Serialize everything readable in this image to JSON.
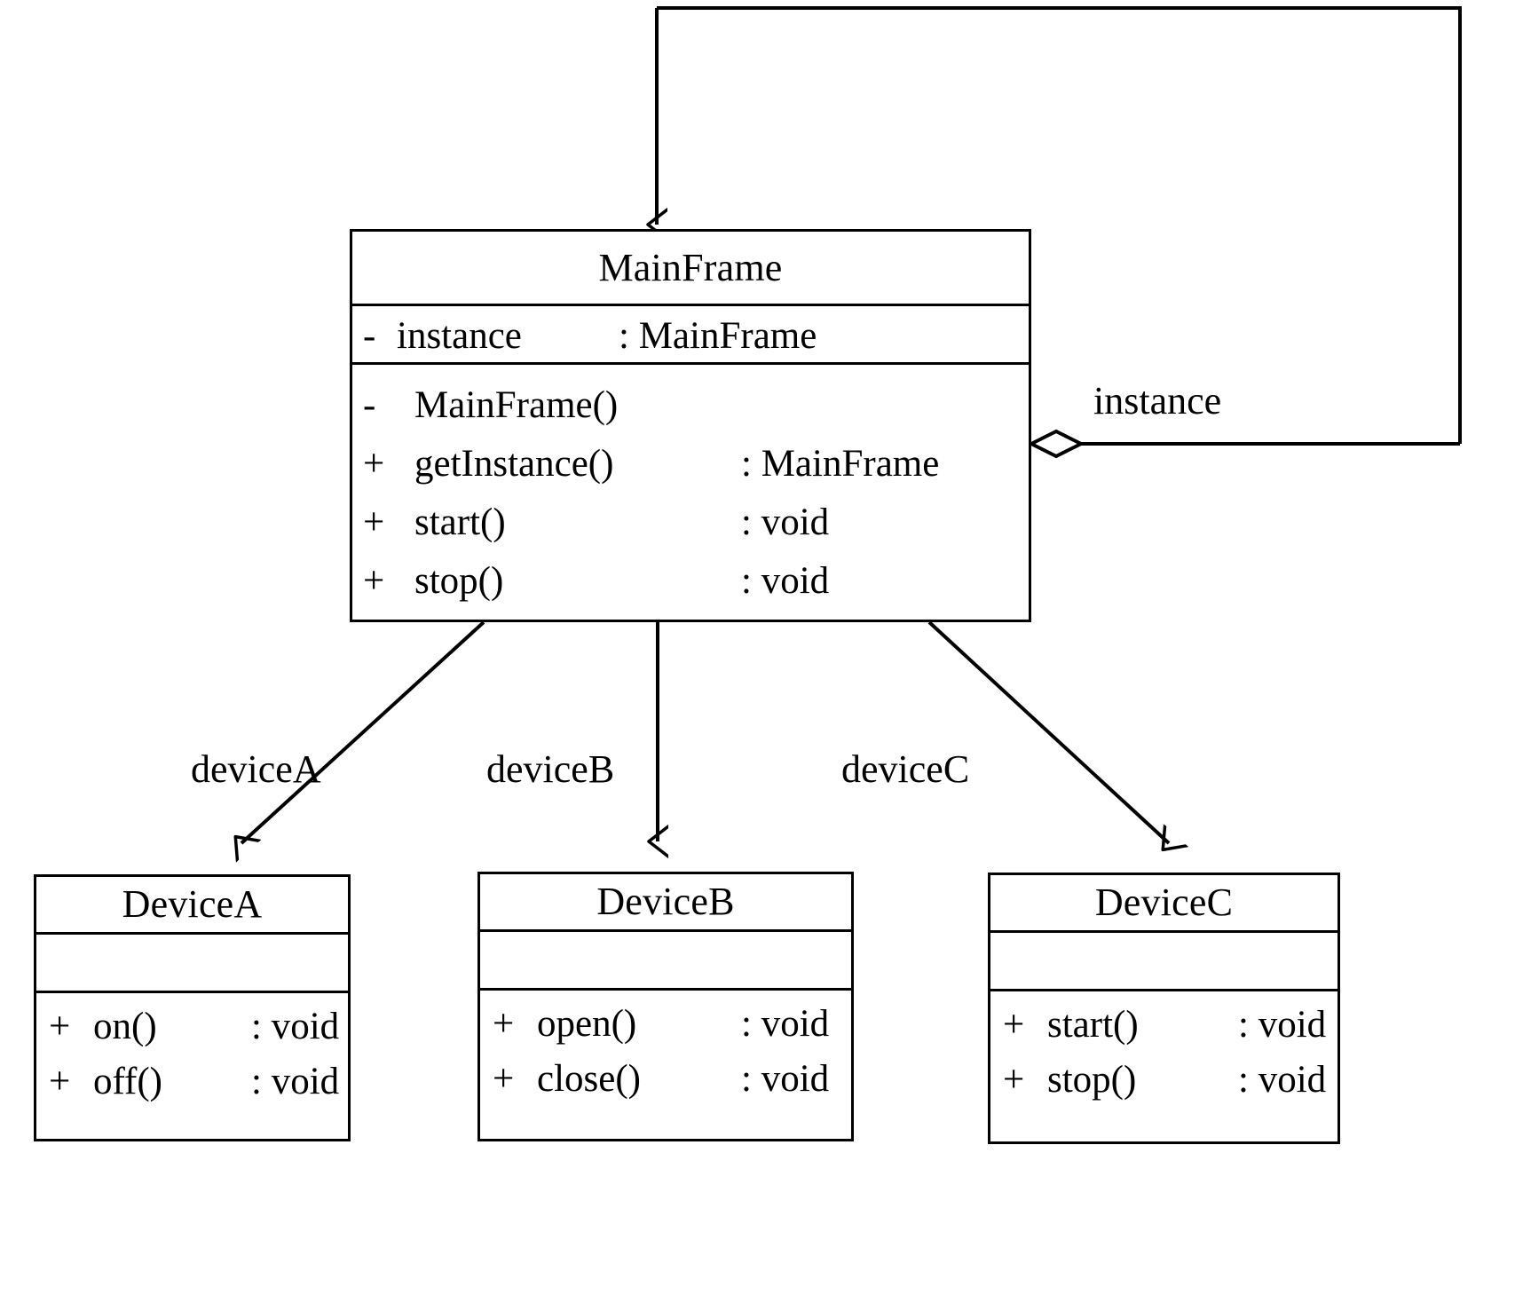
{
  "diagram": {
    "type": "uml-class-diagram",
    "classes": [
      {
        "id": "mainframe",
        "name": "MainFrame",
        "attributes": [
          {
            "visibility": "-",
            "name": "instance",
            "type": ": MainFrame"
          }
        ],
        "operations": [
          {
            "visibility": "-",
            "name": "MainFrame()",
            "type": ""
          },
          {
            "visibility": "+",
            "name": "getInstance()",
            "type": ": MainFrame"
          },
          {
            "visibility": "+",
            "name": "start()",
            "type": ": void"
          },
          {
            "visibility": "+",
            "name": "stop()",
            "type": ": void"
          }
        ]
      },
      {
        "id": "deviceA",
        "name": "DeviceA",
        "attributes": [],
        "operations": [
          {
            "visibility": "+",
            "name": "on()",
            "type": ": void"
          },
          {
            "visibility": "+",
            "name": "off()",
            "type": ": void"
          }
        ]
      },
      {
        "id": "deviceB",
        "name": "DeviceB",
        "attributes": [],
        "operations": [
          {
            "visibility": "+",
            "name": "open()",
            "type": ": void"
          },
          {
            "visibility": "+",
            "name": "close()",
            "type": ": void"
          }
        ]
      },
      {
        "id": "deviceC",
        "name": "DeviceC",
        "attributes": [],
        "operations": [
          {
            "visibility": "+",
            "name": "start()",
            "type": ": void"
          },
          {
            "visibility": "+",
            "name": "stop()",
            "type": ": void"
          }
        ]
      }
    ],
    "relations": [
      {
        "id": "rel-instance",
        "kind": "aggregation-self",
        "label": "instance",
        "from": "mainframe",
        "to": "mainframe"
      },
      {
        "id": "rel-deviceA",
        "kind": "association",
        "label": "deviceA",
        "from": "mainframe",
        "to": "deviceA"
      },
      {
        "id": "rel-deviceB",
        "kind": "association",
        "label": "deviceB",
        "from": "mainframe",
        "to": "deviceB"
      },
      {
        "id": "rel-deviceC",
        "kind": "association",
        "label": "deviceC",
        "from": "mainframe",
        "to": "deviceC"
      }
    ],
    "colors": {
      "stroke": "#000000",
      "fill": "#ffffff",
      "text": "#000000"
    }
  }
}
